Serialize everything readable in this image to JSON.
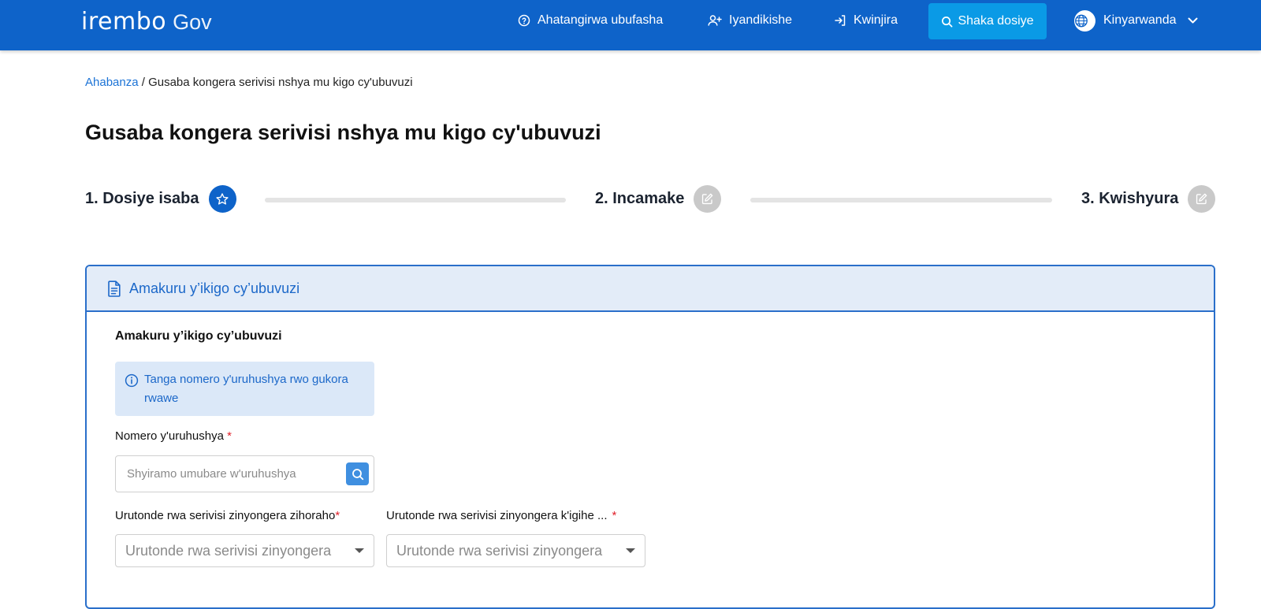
{
  "header": {
    "logo_brand": "irembo",
    "logo_suffix": "Gov",
    "nav": {
      "help": "Ahatangirwa ubufasha",
      "register": "Iyandikishe",
      "login": "Kwinjira",
      "search": "Shaka dosiye",
      "language": "Kinyarwanda"
    }
  },
  "breadcrumb": {
    "home": "Ahabanza",
    "separator": " / ",
    "current": "Gusaba kongera serivisi nshya mu kigo cy'ubuvuzi"
  },
  "page_title": "Gusaba kongera serivisi nshya mu kigo cy'ubuvuzi",
  "stepper": {
    "steps": [
      {
        "label": "1. Dosiye isaba",
        "status": "active",
        "icon": "star-icon"
      },
      {
        "label": "2. Incamake",
        "status": "inactive",
        "icon": "edit-icon"
      },
      {
        "label": "3. Kwishyura",
        "status": "inactive",
        "icon": "edit-icon"
      }
    ]
  },
  "form": {
    "card_title": "Amakuru y’ikigo cy’ubuvuzi",
    "section_title": "Amakuru y’ikigo cy’ubuvuzi",
    "info_text": "Tanga nomero y'uruhushya rwo gukora rwawe",
    "license_label": "Nomero y'uruhushya",
    "license_placeholder": "Shyiramo umubare w'uruhushya",
    "license_value": "",
    "select1_label": "Urutonde rwa serivisi zinyongera zihoraho",
    "select1_value": "Urutonde rwa serivisi zinyongera",
    "select2_label": "Urutonde rwa serivisi zinyongera k'igihe ...",
    "select2_value": "Urutonde rwa serivisi zinyongera",
    "required_mark": "*"
  },
  "colors": {
    "primary": "#0e63c9",
    "search_button": "#0a9ae6",
    "header_bg": "#e3ecf8",
    "required": "#e0202a"
  }
}
